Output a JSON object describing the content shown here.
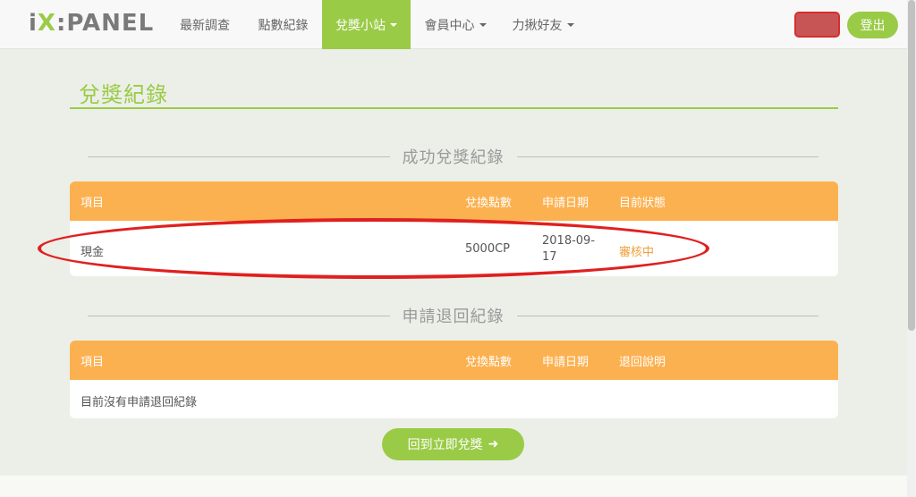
{
  "logo": {
    "prefix": "i",
    "x": "X",
    "rest": ":PANEL"
  },
  "nav": {
    "items": [
      {
        "label": "最新調查"
      },
      {
        "label": "點數紀錄"
      },
      {
        "label": "兌獎小站"
      },
      {
        "label": "會員中心"
      },
      {
        "label": "力揪好友"
      }
    ],
    "logout_label": "登出"
  },
  "page": {
    "title": "兌獎紀錄"
  },
  "success_section": {
    "heading": "成功兌獎紀錄",
    "columns": [
      "項目",
      "兌換點數",
      "申請日期",
      "目前狀態"
    ],
    "rows": [
      {
        "item": "現金",
        "points": "5000CP",
        "date_line1": "2018-09-",
        "date_line2": "17",
        "status": "審核中"
      }
    ]
  },
  "refund_section": {
    "heading": "申請退回紀錄",
    "columns": [
      "項目",
      "兌換點數",
      "申請日期",
      "退回說明"
    ],
    "empty_text": "目前沒有申請退回紀錄"
  },
  "back_button": {
    "label": "回到立即兌獎"
  },
  "colors": {
    "accent_green": "#9acb47",
    "table_header_orange": "#fcb150",
    "status_orange": "#f0a03a",
    "annotation_red": "#e02020"
  }
}
